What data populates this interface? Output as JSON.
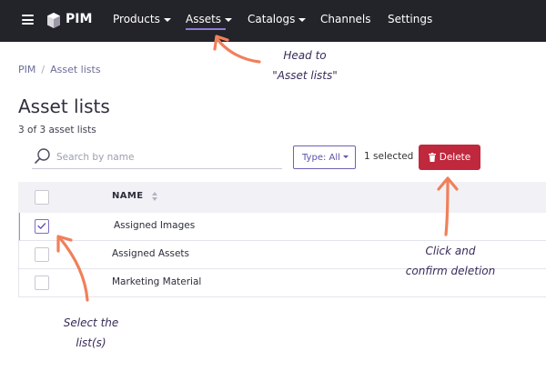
{
  "topbar": {
    "brand": "PIM",
    "nav": [
      {
        "label": "Products",
        "dropdown": true
      },
      {
        "label": "Assets",
        "dropdown": true,
        "active": true
      },
      {
        "label": "Catalogs",
        "dropdown": true
      },
      {
        "label": "Channels",
        "dropdown": false
      },
      {
        "label": "Settings",
        "dropdown": false
      }
    ]
  },
  "breadcrumb": {
    "root": "PIM",
    "current": "Asset lists"
  },
  "page": {
    "title": "Asset lists",
    "count": "3 of 3 asset lists"
  },
  "toolbar": {
    "search_placeholder": "Search by name",
    "type_filter": "Type: All",
    "selected": "1 selected",
    "delete": "Delete"
  },
  "table": {
    "column_name": "NAME",
    "rows": [
      {
        "name": "Assigned Images",
        "checked": true
      },
      {
        "name": "Assigned Assets",
        "checked": false
      },
      {
        "name": "Marketing Material",
        "checked": false
      }
    ]
  },
  "annotations": {
    "nav_line1": "Head to",
    "nav_line2": "\"Asset lists\"",
    "delete_line1": "Click and",
    "delete_line2": "confirm deletion",
    "select_line1": "Select the",
    "select_line2": "list(s)"
  },
  "colors": {
    "topbar": "#23242a",
    "accent": "#8f7ad6",
    "delete": "#c0283d",
    "arrow": "#f0805a",
    "selected_row_marker": "#4ab4e8"
  }
}
